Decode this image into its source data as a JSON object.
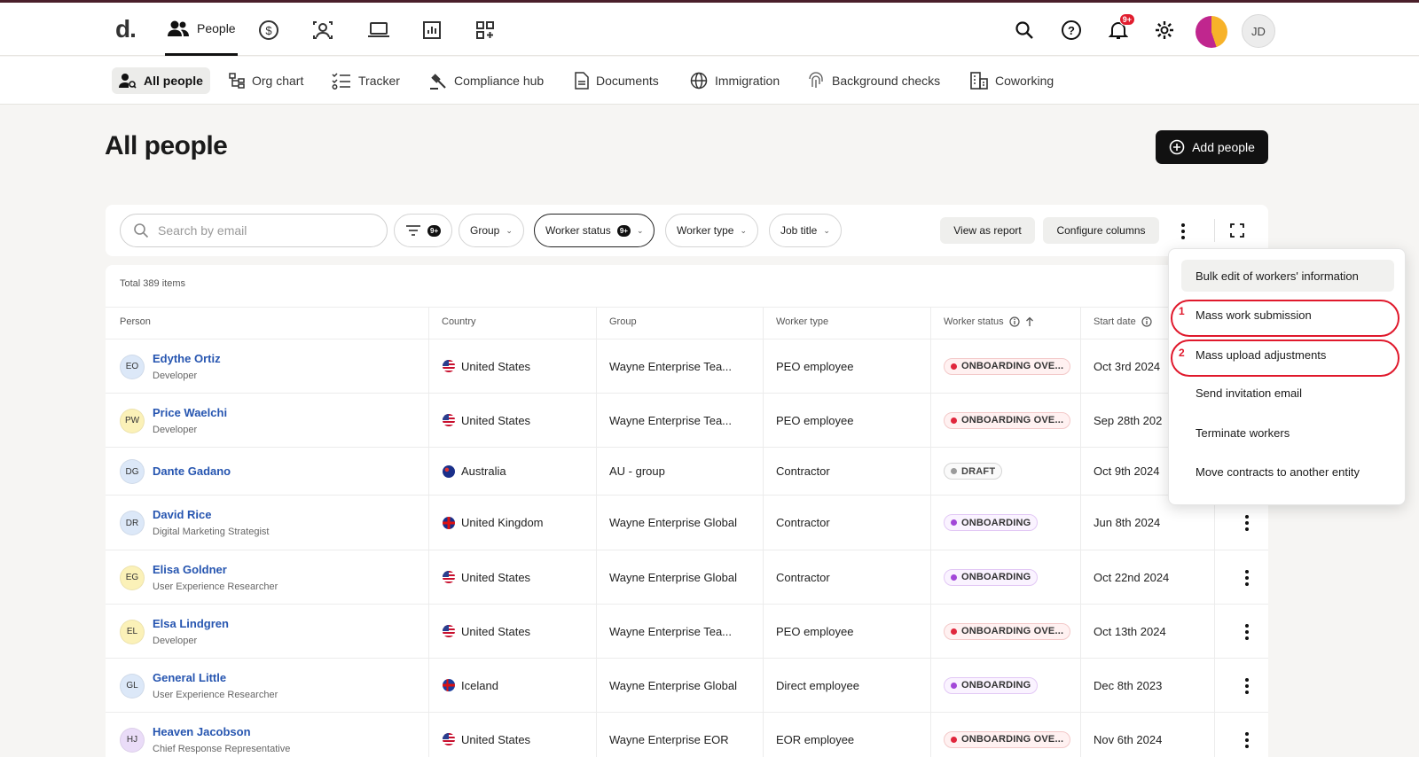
{
  "topnav": {
    "logo": "d.",
    "people_label": "People",
    "notif_count": "9+",
    "user_initials": "JD"
  },
  "subnav": [
    "All people",
    "Org chart",
    "Tracker",
    "Compliance hub",
    "Documents",
    "Immigration",
    "Background checks",
    "Coworking"
  ],
  "page": {
    "title": "All people",
    "add_people": "Add people"
  },
  "filters": {
    "search_placeholder": "Search by email",
    "filter_count": "9+",
    "group": "Group",
    "worker_status": "Worker status",
    "worker_status_count": "9+",
    "worker_type": "Worker type",
    "job_title": "Job title",
    "view_as_report": "View as report",
    "configure_columns": "Configure columns"
  },
  "table": {
    "total": "Total 389 items",
    "headers": [
      "Person",
      "Country",
      "Group",
      "Worker type",
      "Worker status",
      "Start date"
    ],
    "rows": [
      {
        "initials": "EO",
        "name": "Edythe Ortiz",
        "role": "Developer",
        "country": "United States",
        "flag": "us",
        "group": "Wayne Enterprise Tea...",
        "type": "PEO employee",
        "status": "ONBOARDING OVE...",
        "status_kind": "red",
        "start": "Oct 3rd 2024",
        "avatar_bg": "#dce8f8"
      },
      {
        "initials": "PW",
        "name": "Price Waelchi",
        "role": "Developer",
        "country": "United States",
        "flag": "us",
        "group": "Wayne Enterprise Tea...",
        "type": "PEO employee",
        "status": "ONBOARDING OVE...",
        "status_kind": "red",
        "start": "Sep 28th 202",
        "avatar_bg": "#fbf1b8"
      },
      {
        "initials": "DG",
        "name": "Dante Gadano",
        "role": "",
        "country": "Australia",
        "flag": "au",
        "group": "AU - group",
        "type": "Contractor",
        "status": "DRAFT",
        "status_kind": "grey",
        "start": "Oct 9th 2024",
        "avatar_bg": "#dce8f8"
      },
      {
        "initials": "DR",
        "name": "David Rice",
        "role": "Digital Marketing Strategist",
        "country": "United Kingdom",
        "flag": "uk",
        "group": "Wayne Enterprise Global",
        "type": "Contractor",
        "status": "ONBOARDING",
        "status_kind": "purple",
        "start": "Jun 8th 2024",
        "avatar_bg": "#dce8f8"
      },
      {
        "initials": "EG",
        "name": "Elisa Goldner",
        "role": "User Experience Researcher",
        "country": "United States",
        "flag": "us",
        "group": "Wayne Enterprise Global",
        "type": "Contractor",
        "status": "ONBOARDING",
        "status_kind": "purple",
        "start": "Oct 22nd 2024",
        "avatar_bg": "#fbf1b8"
      },
      {
        "initials": "EL",
        "name": "Elsa Lindgren",
        "role": "Developer",
        "country": "United States",
        "flag": "us",
        "group": "Wayne Enterprise Tea...",
        "type": "PEO employee",
        "status": "ONBOARDING OVE...",
        "status_kind": "red",
        "start": "Oct 13th 2024",
        "avatar_bg": "#fbf1b8"
      },
      {
        "initials": "GL",
        "name": "General Little",
        "role": "User Experience Researcher",
        "country": "Iceland",
        "flag": "is",
        "group": "Wayne Enterprise Global",
        "type": "Direct employee",
        "status": "ONBOARDING",
        "status_kind": "purple",
        "start": "Dec 8th 2023",
        "avatar_bg": "#dce8f8"
      },
      {
        "initials": "HJ",
        "name": "Heaven Jacobson",
        "role": "Chief Response Representative",
        "country": "United States",
        "flag": "us",
        "group": "Wayne Enterprise EOR",
        "type": "EOR employee",
        "status": "ONBOARDING OVE...",
        "status_kind": "red",
        "start": "Nov 6th 2024",
        "avatar_bg": "#eadcf8"
      }
    ]
  },
  "menu": {
    "items": [
      "Bulk edit of workers' information",
      "Mass work submission",
      "Mass upload adjustments",
      "Send invitation email",
      "Terminate workers",
      "Move contracts to another entity"
    ],
    "markers": [
      "1",
      "2"
    ]
  }
}
